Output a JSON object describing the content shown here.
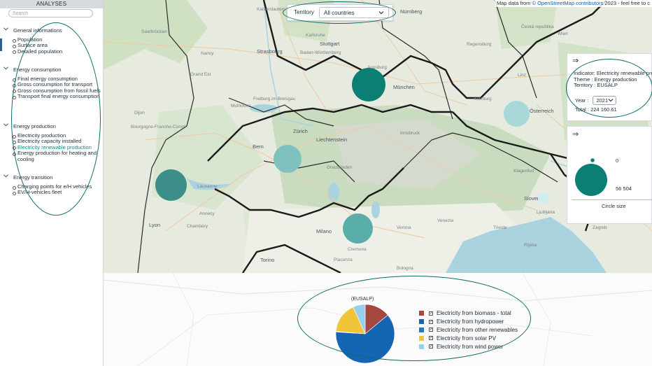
{
  "sidebar": {
    "title": "ANALYSES",
    "search_placeholder": "Search",
    "sections": [
      {
        "title": "General informations",
        "items": [
          {
            "label": "Population"
          },
          {
            "label": "Surface area"
          },
          {
            "label": "Detailed population"
          }
        ]
      },
      {
        "title": "Energy consumption",
        "items": [
          {
            "label": "Final energy consumption"
          },
          {
            "label": "Gross consumption for transport"
          },
          {
            "label": "Gross consumption from fossil fuels"
          },
          {
            "label": "Transport final energy consumption"
          }
        ]
      },
      {
        "title": "Energy production",
        "items": [
          {
            "label": "Electricity production"
          },
          {
            "label": "Electricity capacity installed"
          },
          {
            "label": "Electricity renewable production",
            "active": true
          },
          {
            "label": "Energy production for heating and cooling"
          }
        ]
      },
      {
        "title": "Energy transition",
        "items": [
          {
            "label": "Charging points for e/H vehicles"
          },
          {
            "label": "EV/H-vehicles fleet"
          }
        ]
      }
    ]
  },
  "map": {
    "attribution_prefix": "Map data from ",
    "attribution_link": "© OpenStreetMap contributors",
    "attribution_suffix": " 2023 - feel free to c",
    "territory_label": "Territory",
    "territory_value": "All countries",
    "cities": [
      "Kaiserslautern",
      "Nürnberg",
      "Saarbrücken",
      "Karlsruhe",
      "Stuttgart",
      "Nancy",
      "Strasbourg",
      "Baden-Württemberg",
      "Regensburg",
      "Grand Est",
      "Freiburg im Breisgau",
      "Augsburg",
      "München",
      "Mulhouse",
      "Bern",
      "Zürich",
      "Liechtenstein",
      "Salzburg",
      "Österreich",
      "Linz",
      "Bourgogne-Franche-Comté",
      "Innsbruck",
      "Dijon",
      "Lausanne",
      "Graubünden",
      "Klagenfurt",
      "Annecy",
      "Lyon",
      "Chambéry",
      "Torino",
      "Milano",
      "Verona",
      "Venezia",
      "Trieste",
      "Slovenija",
      "Ljubljana",
      "Zagreb",
      "Cremona",
      "Bologna",
      "Česká republika",
      "Rijeka",
      "Piacenza",
      "Wien"
    ],
    "bubble_colors": {
      "large": "#0c7f74",
      "medium": "#5aaeaa",
      "light": "#a8d9d8",
      "pale": "#cfeef0"
    }
  },
  "info_panel": {
    "arrow": "⇒",
    "indicator": "Indicator: Electricity renewable produ",
    "theme": "Theme : Energy production",
    "territory": "Territory : EUSALP",
    "year_label": "Year :",
    "year_value": "2021",
    "total": "Total : 224 160.61"
  },
  "size_legend": {
    "arrow": "⇒",
    "min_value": "0",
    "max_value": "56 504",
    "caption": "Circle size"
  },
  "chart_data": {
    "type": "pie",
    "title": "(EUSALP)",
    "categories": [
      "Electricity from biomass - total",
      "Electricity from hydropower",
      "Electricity from other renewables",
      "Electricity from solar PV",
      "Electricity from wind power"
    ],
    "values": [
      14,
      62,
      0.3,
      17,
      6.7
    ],
    "colors": [
      "#a5463f",
      "#1565b5",
      "#2a78bd",
      "#f0c53a",
      "#96d0ee"
    ],
    "legend_position": "right"
  }
}
